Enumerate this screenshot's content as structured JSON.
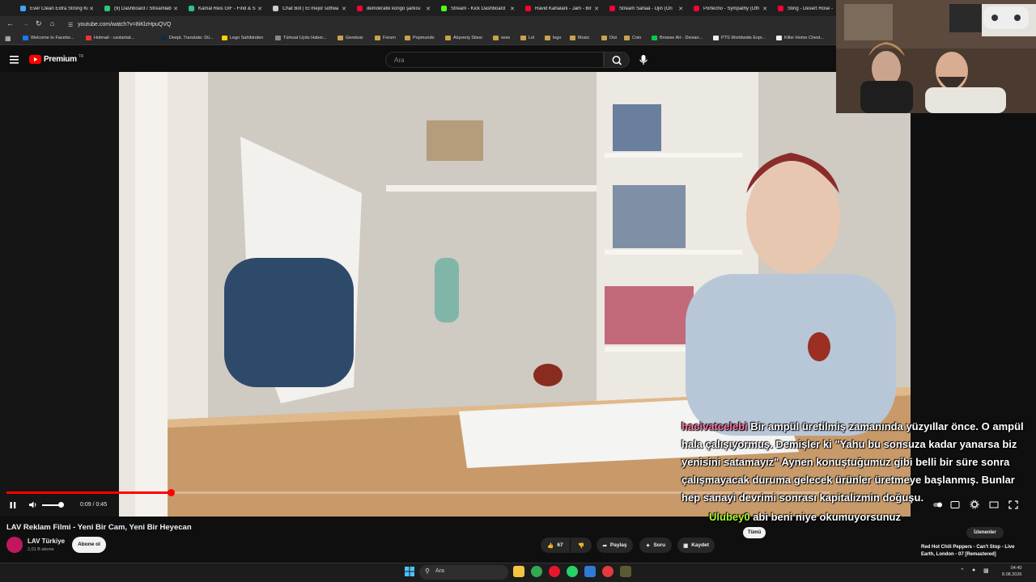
{
  "browser": {
    "tabs": [
      {
        "label": "Ever Clean Extra Strong Ki",
        "color": "#3ea6ff"
      },
      {
        "label": "(9) Dashboard / Streamlab",
        "color": "#31c27c"
      },
      {
        "label": "Kamal Reis GIF - Find & S",
        "color": "#30c18b"
      },
      {
        "label": "Chat Bot | El mejor softwa",
        "color": "#cccccc"
      },
      {
        "label": "demokratik kongo şarkısı",
        "color": "#ff0033"
      },
      {
        "label": "Stream - Kick Dashboard",
        "color": "#53fc18"
      },
      {
        "label": "Ravid Kahalani - Jam - Bir",
        "color": "#ff0033"
      },
      {
        "label": "Stream Sahaâ - Djin (Ori",
        "color": "#ff0033"
      },
      {
        "label": "Portecho - Sympathy (Offi",
        "color": "#ff0033"
      },
      {
        "label": "Sting - Desert Rose -",
        "color": "#ff0033"
      }
    ],
    "url": "youtube.com/watch?v=8iKlzHpuQVQ",
    "bookmarks": [
      {
        "label": "Welcome to Facebo..."
      },
      {
        "label": "Hotmail - cavlantat..."
      },
      {
        "label": "DeepL Translate: Dü..."
      },
      {
        "label": "Lego Sahibinden"
      },
      {
        "label": "Türksat Uydu Haber..."
      },
      {
        "label": "Gereksiz"
      },
      {
        "label": "Forum"
      },
      {
        "label": "Popmundo"
      },
      {
        "label": "Alışveriş Sitesi"
      },
      {
        "label": "wow"
      },
      {
        "label": "Lol"
      },
      {
        "label": "lego"
      },
      {
        "label": "Music"
      },
      {
        "label": "Dizi"
      },
      {
        "label": "Coin"
      },
      {
        "label": "Browse Art - Devian..."
      },
      {
        "label": "PTS Worldwide Expr..."
      },
      {
        "label": "Killer Home Chest..."
      }
    ]
  },
  "youtube": {
    "logo_text": "Premium",
    "logo_superscript": "TR",
    "search_placeholder": "Ara",
    "player": {
      "time": "0:09 / 0:45",
      "progress": 0.2
    },
    "video_title": "LAV Reklam Filmi - Yeni Bir Cam, Yeni Bir Heyecan",
    "channel": "LAV Türkiye",
    "subscribers": "2,01 B abone",
    "subscribe_label": "Abone ol",
    "likes": "67",
    "share_label": "Paylaş",
    "ask_label": "Soru",
    "save_label": "Kaydet",
    "chip_all": "Tümü",
    "chip_watched": "İzlenenler"
  },
  "chat_overlay": {
    "messages": [
      {
        "user": "hacivatcelebi",
        "text": "Bir ampül üretilmiş zamanında yüzyıllar önce. O ampül hala çalışıyormuş. Demişler ki \"Yahu bu sonsuza kadar yanarsa biz yenisini satamayız\" Aynen konuştuğumuz gibi belli bir süre sonra çalışmayacak duruma gelecek ürünler üretmeye başlanmış. Bunlar hep sanayi devrimi sonrası kapitalizmin doğuşu.",
        "user_color": "#ff7ba7"
      },
      {
        "user": "Ulubey0",
        "text": "abi beni niye okumuyorsunuz",
        "user_color": "#adff2f"
      }
    ]
  },
  "now_playing": "Red Hot Chili Peppers - Can't Stop - Live Earth, London - 07 [Remastered]",
  "taskbar": {
    "search_label": "Ara",
    "time": "04:40",
    "date": "8.08.2026"
  }
}
